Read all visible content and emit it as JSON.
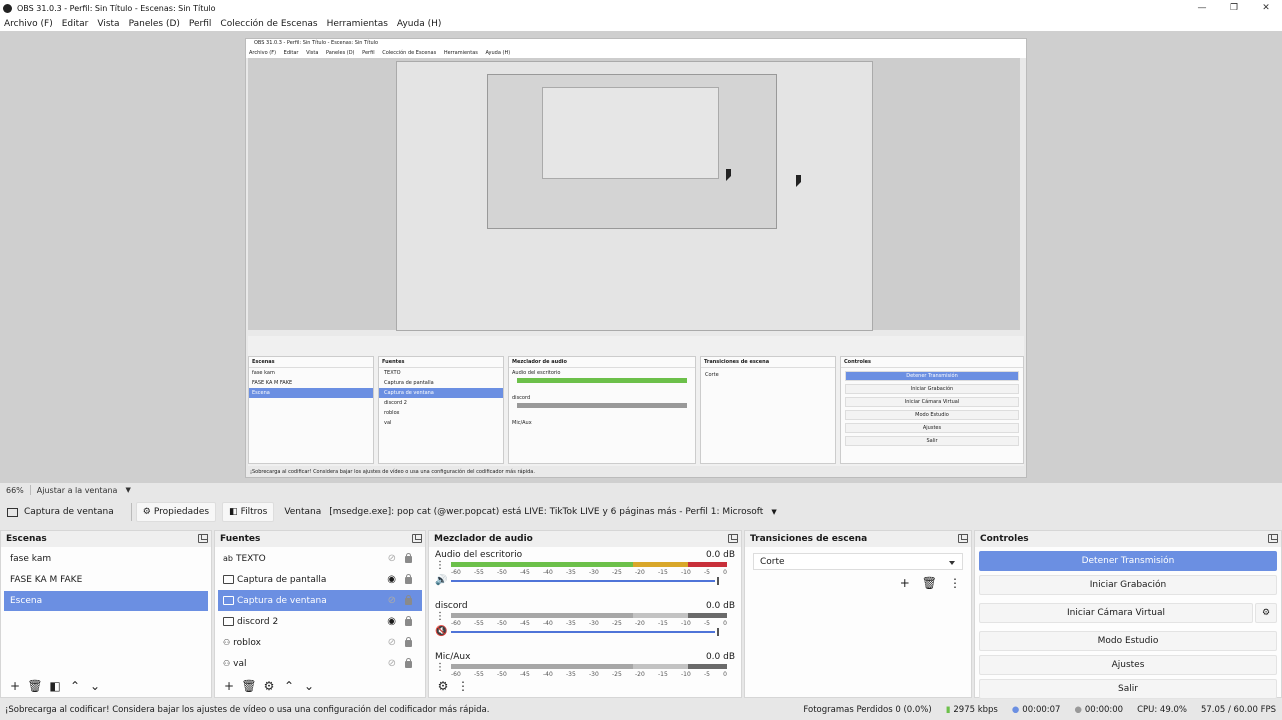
{
  "window": {
    "title": "OBS 31.0.3 - Perfil: Sin Título - Escenas: Sin Título"
  },
  "menu": [
    "Archivo (F)",
    "Editar",
    "Vista",
    "Paneles (D)",
    "Perfil",
    "Colección de Escenas",
    "Herramientas",
    "Ayuda (H)"
  ],
  "zoom": {
    "level": "66%",
    "fit_label": "Ajustar a la ventana"
  },
  "toolbar": {
    "source_name": "Captura de ventana",
    "properties": "Propiedades",
    "filters": "Filtros",
    "window_label": "Ventana",
    "window_value": "[msedge.exe]: pop cat (@wer.popcat) está LIVE: TikTok LIVE y 6 páginas más - Perfil 1: Microsoft"
  },
  "scenes": {
    "title": "Escenas",
    "items": [
      "fase kam",
      "FASE KA  M FAKE",
      "Escena"
    ],
    "selected": 2
  },
  "sources": {
    "title": "Fuentes",
    "items": [
      {
        "name": "TEXTO",
        "visible": false
      },
      {
        "name": "Captura de pantalla",
        "visible": true
      },
      {
        "name": "Captura de ventana",
        "visible": false
      },
      {
        "name": "discord 2",
        "visible": true
      },
      {
        "name": "roblox",
        "visible": false
      },
      {
        "name": "val",
        "visible": false
      }
    ],
    "selected": 2
  },
  "mixer": {
    "title": "Mezclador de audio",
    "channels": [
      {
        "name": "Audio del escritorio",
        "db": "0.0 dB",
        "muted": false
      },
      {
        "name": "discord",
        "db": "0.0 dB",
        "muted": true
      },
      {
        "name": "Mic/Aux",
        "db": "0.0 dB",
        "muted": false
      }
    ],
    "scale": [
      "-60",
      "-55",
      "-50",
      "-45",
      "-40",
      "-35",
      "-30",
      "-25",
      "-20",
      "-15",
      "-10",
      "-5",
      "0"
    ]
  },
  "transitions": {
    "title": "Transiciones de escena",
    "selected": "Corte"
  },
  "controls": {
    "title": "Controles",
    "stop_stream": "Detener Transmisión",
    "start_record": "Iniciar Grabación",
    "virtual_cam": "Iniciar Cámara Virtual",
    "studio_mode": "Modo Estudio",
    "settings": "Ajustes",
    "exit": "Salir"
  },
  "status": {
    "warning": "¡Sobrecarga al codificar! Considera bajar los ajustes de vídeo o usa una configuración del codificador más rápida.",
    "dropped": "Fotogramas Perdidos 0 (0.0%)",
    "bitrate": "2975 kbps",
    "stream_time": "00:00:07",
    "rec_time": "00:00:00",
    "cpu": "CPU: 49.0%",
    "fps": "57.05 / 60.00 FPS"
  },
  "colors": {
    "accent": "#6b8fe2",
    "meter_green": "#6cc04a",
    "meter_yellow": "#d9a72a",
    "meter_red": "#c8303a"
  }
}
